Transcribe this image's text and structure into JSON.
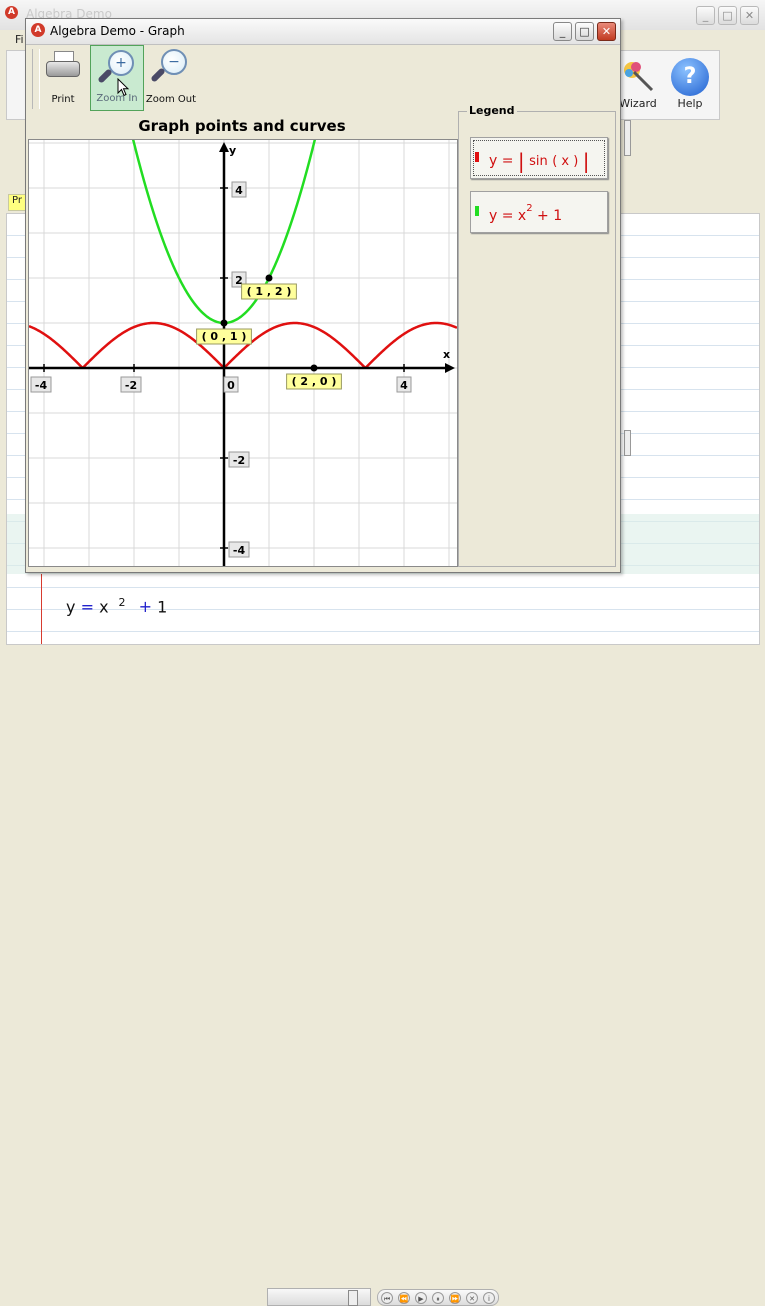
{
  "main_window": {
    "title": "Algebra Demo",
    "menu_first": "Fi",
    "tools": [
      {
        "label": "Wizard",
        "icon": "magic-wand-icon"
      },
      {
        "label": "Help",
        "icon": "help-icon"
      }
    ],
    "tab_label": "Pr",
    "equation": {
      "lhs": "y",
      "eq": "=",
      "base": "x",
      "exp": "2",
      "plus": "+",
      "const": "1"
    }
  },
  "dialog": {
    "title": "Algebra Demo - Graph",
    "toolbar": [
      {
        "label": "Print",
        "icon": "printer-icon"
      },
      {
        "label": "Zoom In",
        "icon": "zoom-in-icon"
      },
      {
        "label": "Zoom Out",
        "icon": "zoom-out-icon"
      }
    ],
    "legend_title": "Legend",
    "legend_items": [
      {
        "lhs": "y =",
        "func": "sin",
        "arg": "( x )",
        "color": "#e01010"
      },
      {
        "lhs": "y =",
        "base": "x",
        "exp": "2",
        "rest": "+ 1",
        "color": "#22dd22"
      }
    ]
  },
  "chart_data": {
    "type": "line",
    "title": "Graph points and curves",
    "xlabel": "x",
    "ylabel": "y",
    "xlim": [
      -4.4,
      5.1
    ],
    "ylim": [
      -4.4,
      5.1
    ],
    "grid": true,
    "x_ticks": [
      "-4",
      "-2",
      "0",
      "4"
    ],
    "y_ticks": [
      "4",
      "2",
      "-2",
      "-4"
    ],
    "series": [
      {
        "name": "y = |sin(x)|",
        "function": "abs_sin",
        "color": "#e01010"
      },
      {
        "name": "y = x^2 + 1",
        "function": "x2_plus_1",
        "color": "#22dd22"
      }
    ],
    "points": [
      {
        "label": "( 1 , 2 )",
        "x": 1,
        "y": 2
      },
      {
        "label": "( 0 , 1 )",
        "x": 0,
        "y": 1
      },
      {
        "label": "( 2 , 0 )",
        "x": 2,
        "y": 0
      }
    ]
  }
}
